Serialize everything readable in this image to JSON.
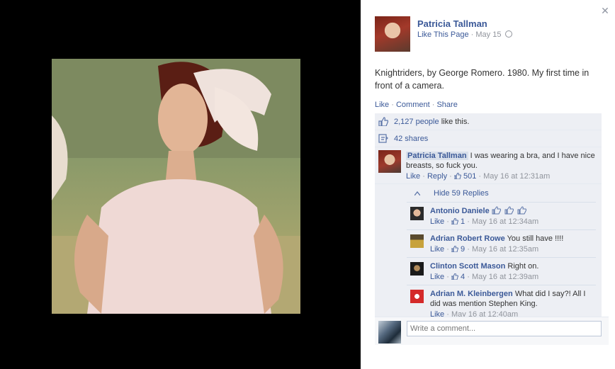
{
  "post": {
    "author": "Patricia Tallman",
    "like_page": "Like This Page",
    "date": "May 15",
    "caption": "Knightriders, by George Romero. 1980. My first time in front of a camera.",
    "actions": {
      "like": "Like",
      "comment": "Comment",
      "share": "Share"
    },
    "likes_count": "2,127 people",
    "likes_suffix": "like this.",
    "shares": "42 shares"
  },
  "comments": [
    {
      "name": "Patricia Tallman",
      "text": "I was wearing a bra, and I have nice breasts, so fuck you.",
      "like": "Like",
      "reply": "Reply",
      "likes": "501",
      "time": "May 16 at 12:31am"
    }
  ],
  "replies_toggle": "Hide 59 Replies",
  "replies": [
    {
      "name": "Antonio Daniele",
      "text": "",
      "like": "Like",
      "likes": "1",
      "time": "May 16 at 12:34am"
    },
    {
      "name": "Adrian Robert Rowe",
      "text": "You still have !!!!",
      "like": "Like",
      "likes": "9",
      "time": "May 16 at 12:35am"
    },
    {
      "name": "Clinton Scott Mason",
      "text": "Right on.",
      "like": "Like",
      "likes": "4",
      "time": "May 16 at 12:39am"
    },
    {
      "name": "Adrian M. Kleinbergen",
      "text": "What did I say?! All I did was mention Stephen King.",
      "like": "Like",
      "likes": "",
      "time": "May 16 at 12:40am"
    }
  ],
  "composer": {
    "placeholder": "Write a comment..."
  },
  "colors": {
    "link": "#3b5998",
    "panel_bg": "#edeff4",
    "muted": "#90949c"
  },
  "icons": [
    "close-icon",
    "globe-icon",
    "thumbs-up-icon",
    "share-icon",
    "caret-up-icon"
  ]
}
